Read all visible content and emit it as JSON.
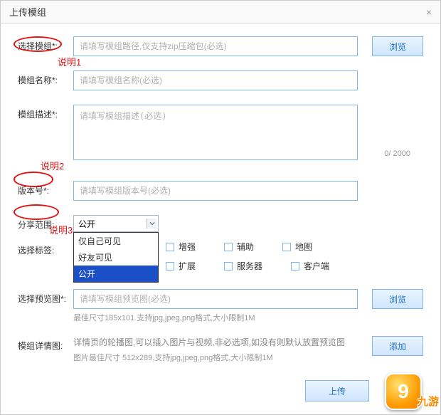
{
  "dialog": {
    "title": "上传模组",
    "close_icon": "×"
  },
  "fields": {
    "mod_select": {
      "label": "选择模组*:",
      "placeholder": "请填写模组路径,仅支持zip压缩包(必选)",
      "browse": "浏览"
    },
    "mod_name": {
      "label": "模组名称*:",
      "placeholder": "请填写模组名称(必选)"
    },
    "mod_desc": {
      "label": "模组描述*:",
      "placeholder": "请填写模组描述(必选)",
      "counter": "0/ 2000"
    },
    "version": {
      "label": "版本号*:",
      "placeholder": "请填写模组版本号(必选)"
    },
    "share": {
      "label": "分享范围:",
      "selected": "公开"
    },
    "tags": {
      "label": "选择标签:"
    },
    "preview": {
      "label": "选择预览图*:",
      "placeholder": "请填写模组预览图(必选)",
      "browse": "浏览",
      "hint": "最佳尺寸185x101 支持jpg,jpeg,png格式,大小限制1M"
    },
    "detail": {
      "label": "模组详情图:",
      "text": "详情页的轮播图,可以插入图片与视频,非必选项,如没有则默认放置预览图",
      "hint": "图片最佳尺寸 512x289,支持jpg,jpeg,png格式,大小限制1M",
      "add": "添加"
    }
  },
  "share_options": [
    "仅自己可见",
    "好友可见",
    "公开"
  ],
  "tag_options": [
    [
      "增强",
      "辅助",
      "地图"
    ],
    [
      "扩展",
      "服务器",
      "客户端"
    ]
  ],
  "submit": "上传",
  "annotations": {
    "note1": "说明1",
    "note2": "说明2",
    "note3": "说明3"
  },
  "logo": {
    "nine": "9",
    "text": "九游"
  }
}
